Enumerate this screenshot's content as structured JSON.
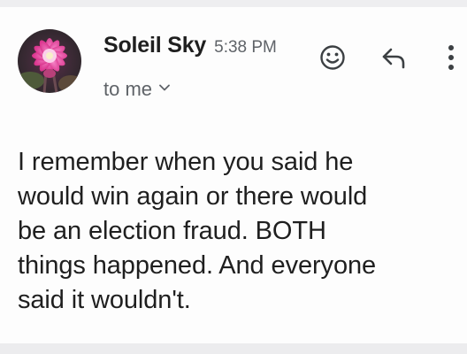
{
  "email": {
    "sender": {
      "name": "Soleil Sky",
      "avatar_icon": "pink-cactus-flower-photo"
    },
    "time": "5:38 PM",
    "recipient_text": "to me",
    "recipient_toggle_icon": "chevron-down-icon",
    "actions": {
      "emoji_icon": "add-reaction-smiley-icon",
      "reply_icon": "reply-arrow-icon",
      "more_icon": "more-vert-icon"
    },
    "body_lines": [
      "I remember when you said he",
      "would win again or there would",
      "be an election fraud. BOTH",
      "things happened. And everyone",
      "said it wouldn't."
    ]
  },
  "colors": {
    "primary_text": "#1f1f1f",
    "secondary_text": "#5f6368",
    "background": "#fdfdfd",
    "avatar_flower": "#e8479a"
  }
}
